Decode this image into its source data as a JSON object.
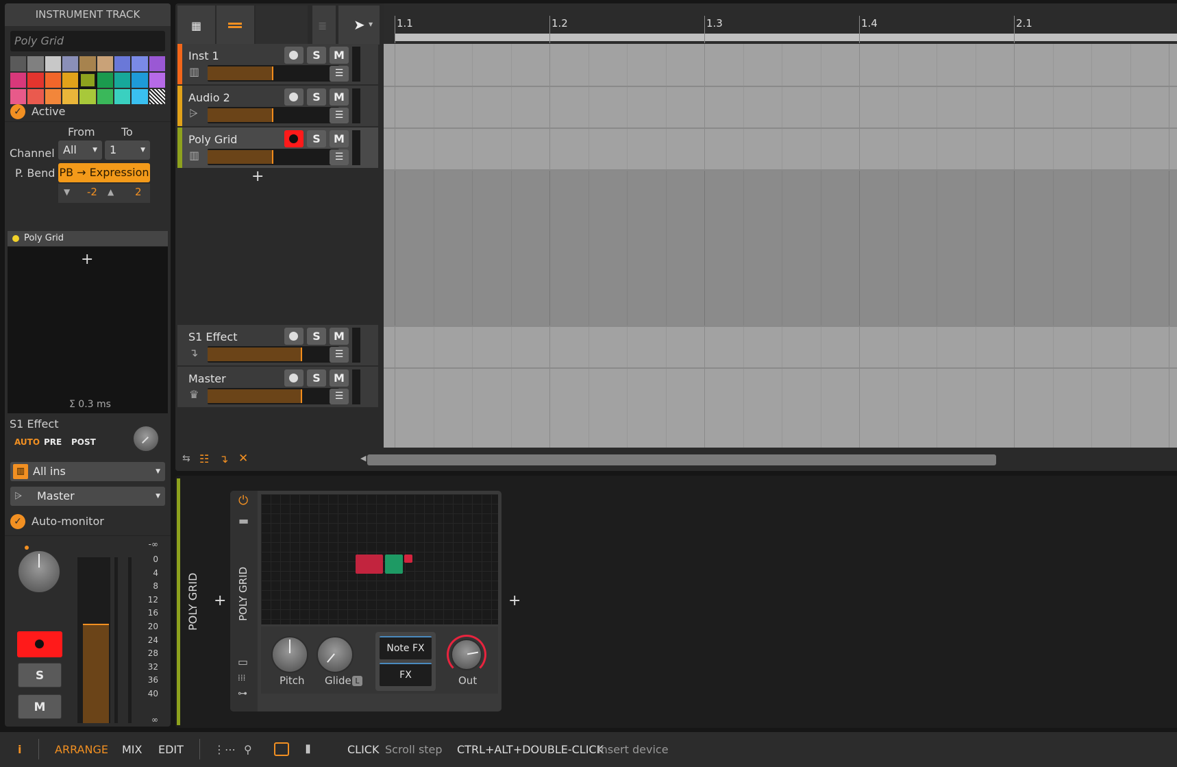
{
  "inspector": {
    "header": "INSTRUMENT TRACK",
    "track_name_placeholder": "Poly Grid",
    "swatch_colors": [
      "#5a5a5a",
      "#808080",
      "#c8c8c8",
      "#8a8fb8",
      "#a7834e",
      "#c9a278",
      "#6a78d8",
      "#7a8ae6",
      "#9a58d4",
      "#d8387a",
      "#e3352e",
      "#f2662a",
      "#e1a21a",
      "#8ea21e",
      "#1b9a4e",
      "#17a89a",
      "#1e9ad8",
      "#b66ae8",
      "#e85a8a",
      "#ea5a4e",
      "#f2863a",
      "#eab63a",
      "#a8c83a",
      "#3ab85a",
      "#3ad0c0",
      "#3ac0f0",
      "hatch"
    ],
    "selected_swatch": 13,
    "active_label": "Active",
    "from_label": "From",
    "to_label": "To",
    "channel_label": "Channel",
    "channel_from": "All",
    "channel_to": "1",
    "pbend_label": "P. Bend",
    "pbend_value": "PB → Expression",
    "pb_down": "-2",
    "pb_up": "2",
    "chain_name": "Poly Grid",
    "latency": "Σ 0.3 ms",
    "send_name": "S1 Effect",
    "send_modes": [
      "AUTO",
      "PRE",
      "POST"
    ],
    "input": "All ins",
    "output": "Master",
    "automonitor_label": "Auto-monitor",
    "meter_scale": [
      "-∞",
      "0",
      "4",
      "8",
      "12",
      "16",
      "20",
      "24",
      "28",
      "32",
      "36",
      "40",
      "∞"
    ],
    "solo": "S",
    "mute": "M",
    "meter_level": 0.6
  },
  "arranger": {
    "ruler": [
      "1.1",
      "1.2",
      "1.3",
      "1.4",
      "2.1"
    ],
    "tracks": [
      {
        "name": "Inst 1",
        "color": "#f2661a",
        "armed": false,
        "level": 0.5,
        "icon": "piano-icon"
      },
      {
        "name": "Audio 2",
        "color": "#e1a21a",
        "armed": false,
        "level": 0.5,
        "icon": "waveform-icon"
      },
      {
        "name": "Poly Grid",
        "color": "#8ea21e",
        "armed": true,
        "level": 0.5,
        "icon": "piano-icon"
      }
    ],
    "effect_tracks": [
      {
        "name": "S1 Effect",
        "color": "#3b3b3b",
        "level": 0.72,
        "icon": "return-icon"
      },
      {
        "name": "Master",
        "color": "#3b3b3b",
        "level": 0.72,
        "icon": "crown-icon"
      }
    ],
    "solo": "S",
    "mute": "M"
  },
  "devices": {
    "chain_label": "POLY GRID",
    "device_label": "POLY GRID",
    "knobs": [
      {
        "label": "Pitch"
      },
      {
        "label": "Glide",
        "badge": "L"
      },
      {
        "label": "Out"
      }
    ],
    "fx_buttons": [
      "Note FX",
      "FX"
    ]
  },
  "statusbar": {
    "views": [
      "ARRANGE",
      "MIX",
      "EDIT"
    ],
    "active_view": "ARRANGE",
    "hint1_key": "CLICK",
    "hint1_text": "Scroll step",
    "hint2_key": "CTRL+ALT+DOUBLE-CLICK",
    "hint2_text": "Insert device"
  }
}
